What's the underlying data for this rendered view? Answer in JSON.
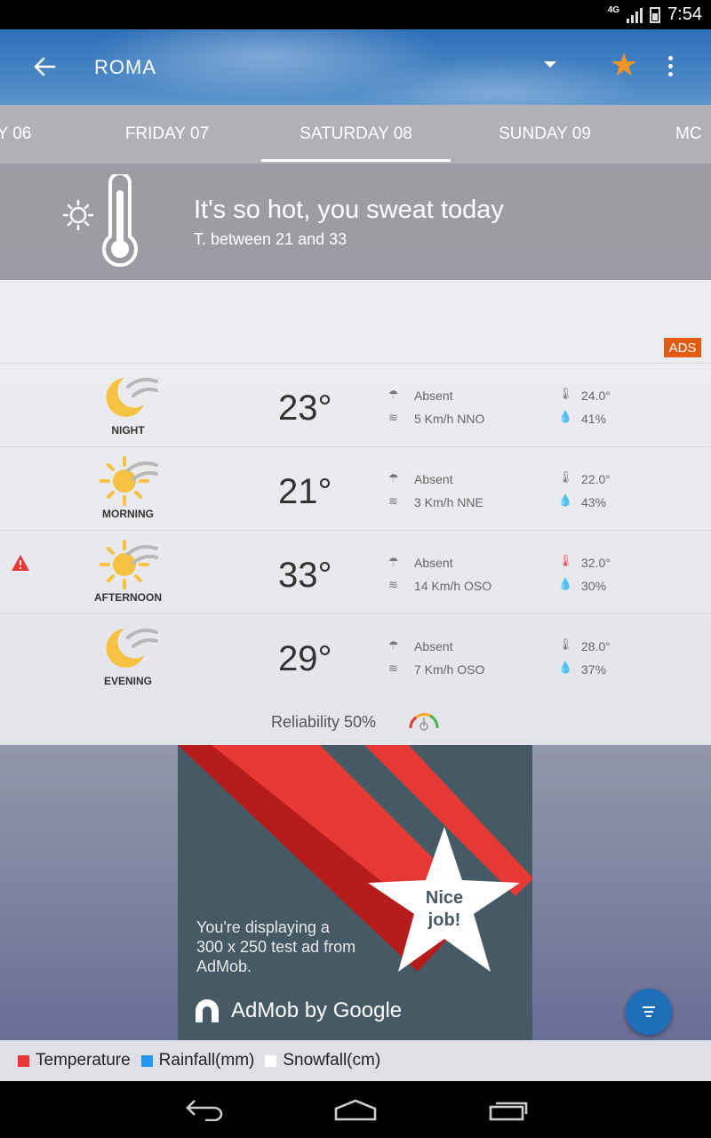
{
  "status_bar": {
    "network": "4G",
    "time": "7:54"
  },
  "app_bar": {
    "city": "ROMA",
    "back_icon": "arrow-left-icon",
    "favorite_icon": "star-icon",
    "menu_icon": "overflow-menu-icon",
    "favorite_color": "#f39324"
  },
  "tabs": [
    {
      "label": "Y 06"
    },
    {
      "label": "FRIDAY 07"
    },
    {
      "label": "SATURDAY 08",
      "active": true
    },
    {
      "label": "SUNDAY 09"
    },
    {
      "label": "MC"
    }
  ],
  "summary": {
    "title": "It's so hot, you sweat today",
    "subtitle": "T. between 21 and 33",
    "icon": "sun-thermometer-icon"
  },
  "ads_badge": "ADS",
  "periods": [
    {
      "label": "NIGHT",
      "temp": "23°",
      "rain": "Absent",
      "wind": "5 Km/h NNO",
      "perceived": "24.0°",
      "humidity": "41%",
      "icon": "moon-cloud-icon",
      "warning": false
    },
    {
      "label": "MORNING",
      "temp": "21°",
      "rain": "Absent",
      "wind": "3 Km/h NNE",
      "perceived": "22.0°",
      "humidity": "43%",
      "icon": "sun-cloud-icon",
      "warning": false
    },
    {
      "label": "AFTERNOON",
      "temp": "33°",
      "rain": "Absent",
      "wind": "14 Km/h OSO",
      "perceived": "32.0°",
      "humidity": "30%",
      "icon": "sun-cloud-icon",
      "warning": true
    },
    {
      "label": "EVENING",
      "temp": "29°",
      "rain": "Absent",
      "wind": "7 Km/h OSO",
      "perceived": "28.0°",
      "humidity": "37%",
      "icon": "moon-cloud-icon",
      "warning": false
    }
  ],
  "reliability": {
    "text": "Reliability 50%",
    "value": 0.5
  },
  "ad": {
    "star_text_line1": "Nice",
    "star_text_line2": "job!",
    "body": "You're displaying a 300 x 250 test ad from AdMob.",
    "brand": "AdMob by Google"
  },
  "legend": [
    {
      "label": "Temperature",
      "color": "#e53935"
    },
    {
      "label": "Rainfall(mm)",
      "color": "#2196f3"
    },
    {
      "label": "Snowfall(cm)",
      "color": "#ffffff"
    }
  ],
  "colors": {
    "accent": "#1e6fb8",
    "ads": "#e25b13",
    "warning": "#e53935"
  }
}
